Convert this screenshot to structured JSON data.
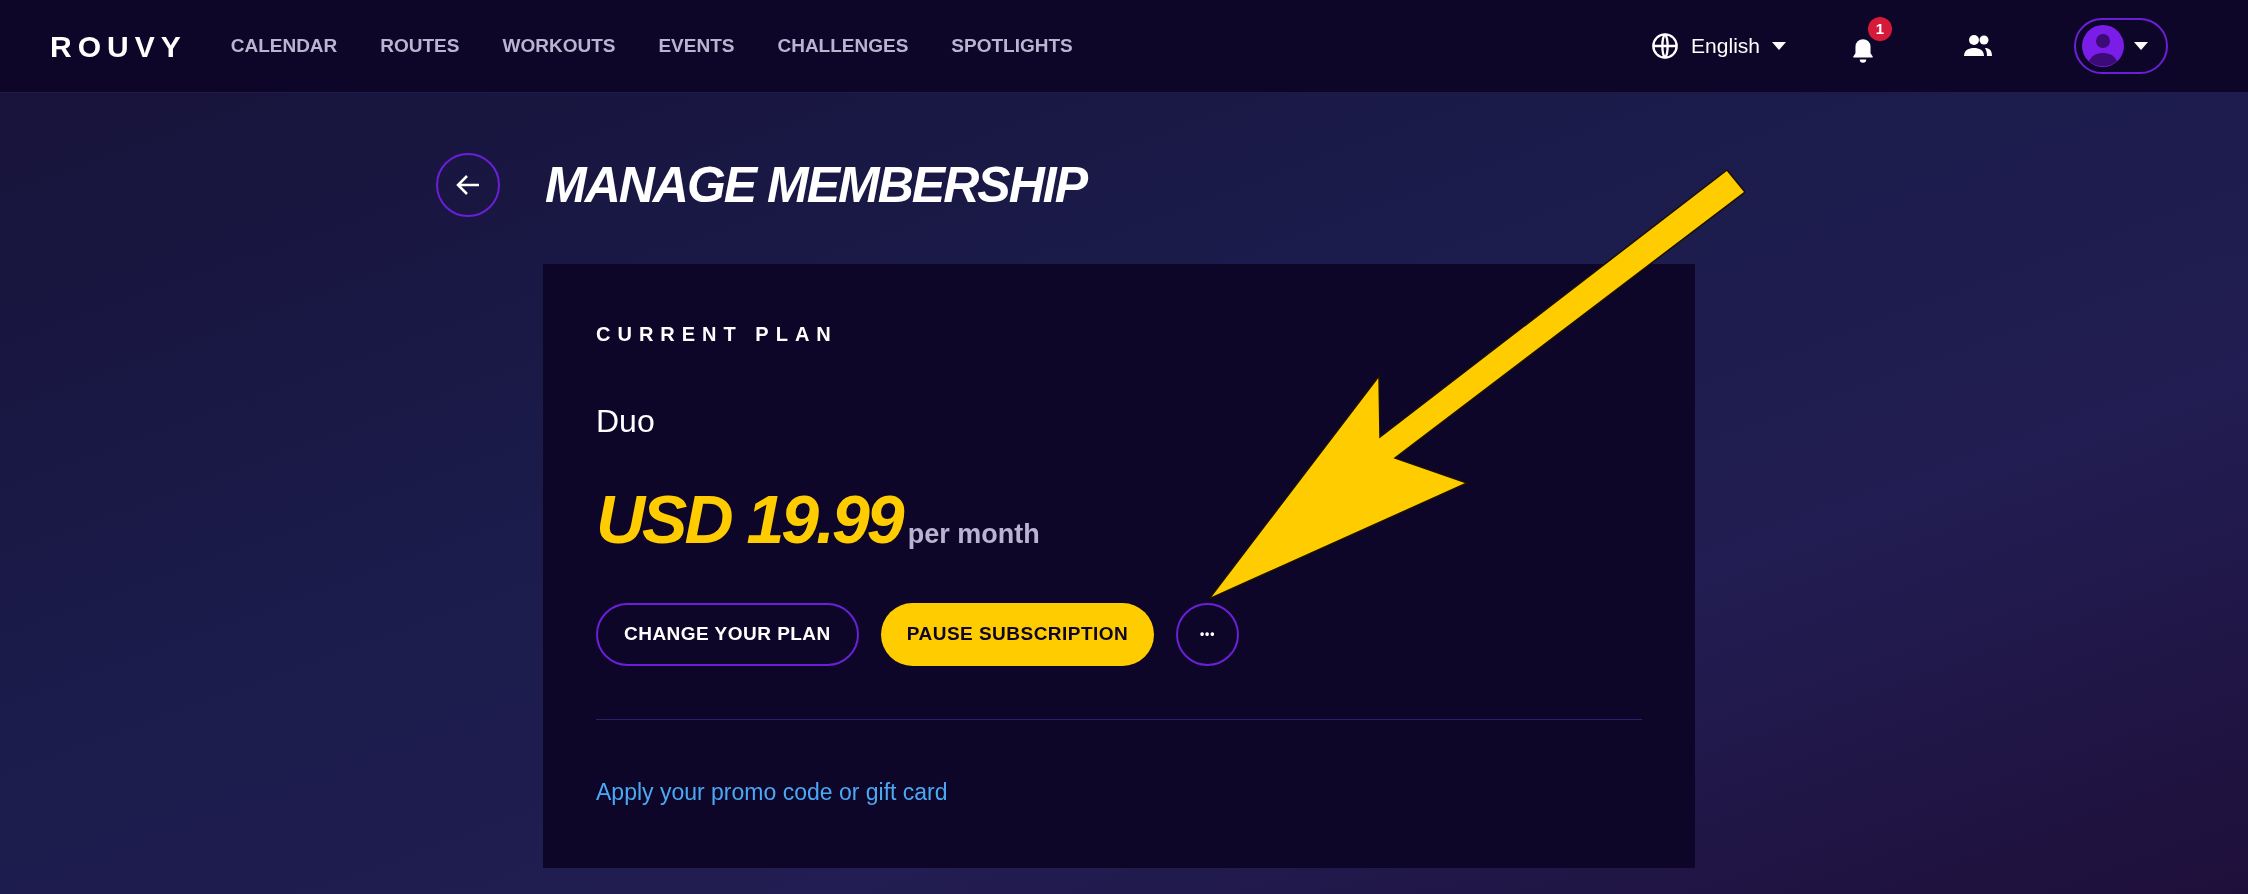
{
  "header": {
    "logo": "ROUVY",
    "nav": [
      {
        "label": "CALENDAR"
      },
      {
        "label": "ROUTES"
      },
      {
        "label": "WORKOUTS"
      },
      {
        "label": "EVENTS"
      },
      {
        "label": "CHALLENGES"
      },
      {
        "label": "SPOTLIGHTS"
      }
    ],
    "language": "English",
    "notification_count": "1"
  },
  "page": {
    "title": "MANAGE MEMBERSHIP"
  },
  "card": {
    "section_label": "CURRENT PLAN",
    "plan_name": "Duo",
    "price": "USD 19.99",
    "period": "per month",
    "buttons": [
      {
        "kind": "outline",
        "label": "CHANGE YOUR PLAN"
      },
      {
        "kind": "primary",
        "label": "PAUSE SUBSCRIPTION"
      },
      {
        "kind": "more",
        "label": "•••"
      }
    ],
    "promo_link": "Apply your promo code or gift card"
  }
}
